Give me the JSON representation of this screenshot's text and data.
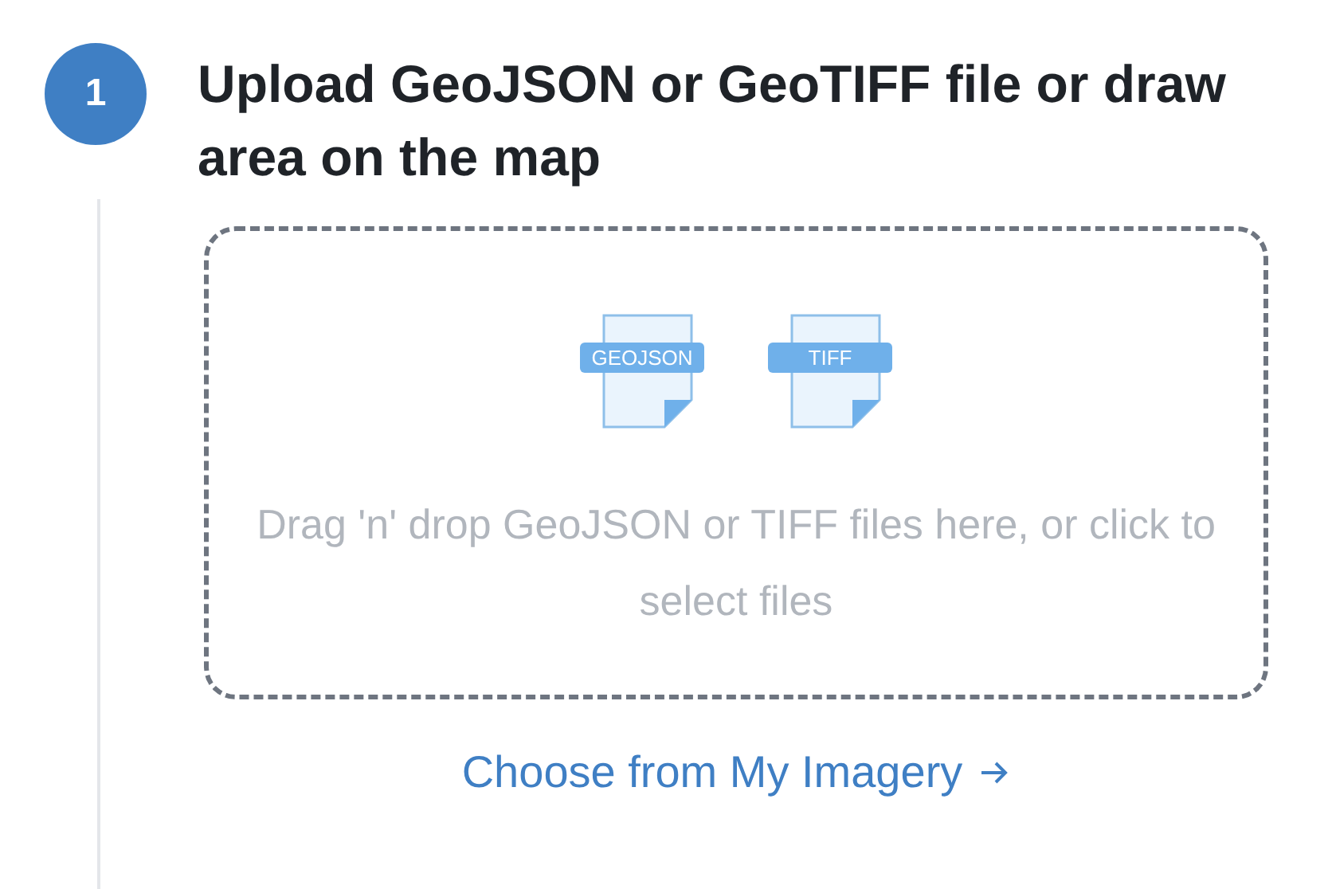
{
  "step": {
    "number": "1",
    "title": "Upload GeoJSON or GeoTIFF file or draw area on the map"
  },
  "dropzone": {
    "file_types": [
      "GEOJSON",
      "TIFF"
    ],
    "text": "Drag 'n' drop GeoJSON or TIFF files here, or click to select files"
  },
  "link": {
    "label": "Choose from My Imagery"
  }
}
